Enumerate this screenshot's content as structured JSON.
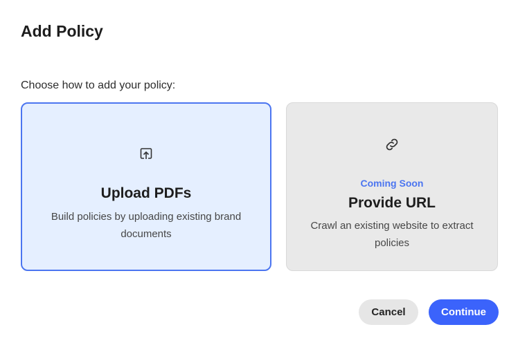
{
  "dialog": {
    "title": "Add Policy",
    "prompt": "Choose how to add your policy:"
  },
  "options": [
    {
      "title": "Upload PDFs",
      "description": "Build policies by uploading existing brand documents",
      "icon": "upload-icon",
      "selected": true
    },
    {
      "badge": "Coming Soon",
      "title": "Provide URL",
      "description": "Crawl an existing website to extract policies",
      "icon": "link-icon",
      "selected": false
    }
  ],
  "buttons": {
    "cancel": "Cancel",
    "continue": "Continue"
  },
  "colors": {
    "accent": "#3b63fb",
    "selected_bg": "#e5efff"
  }
}
